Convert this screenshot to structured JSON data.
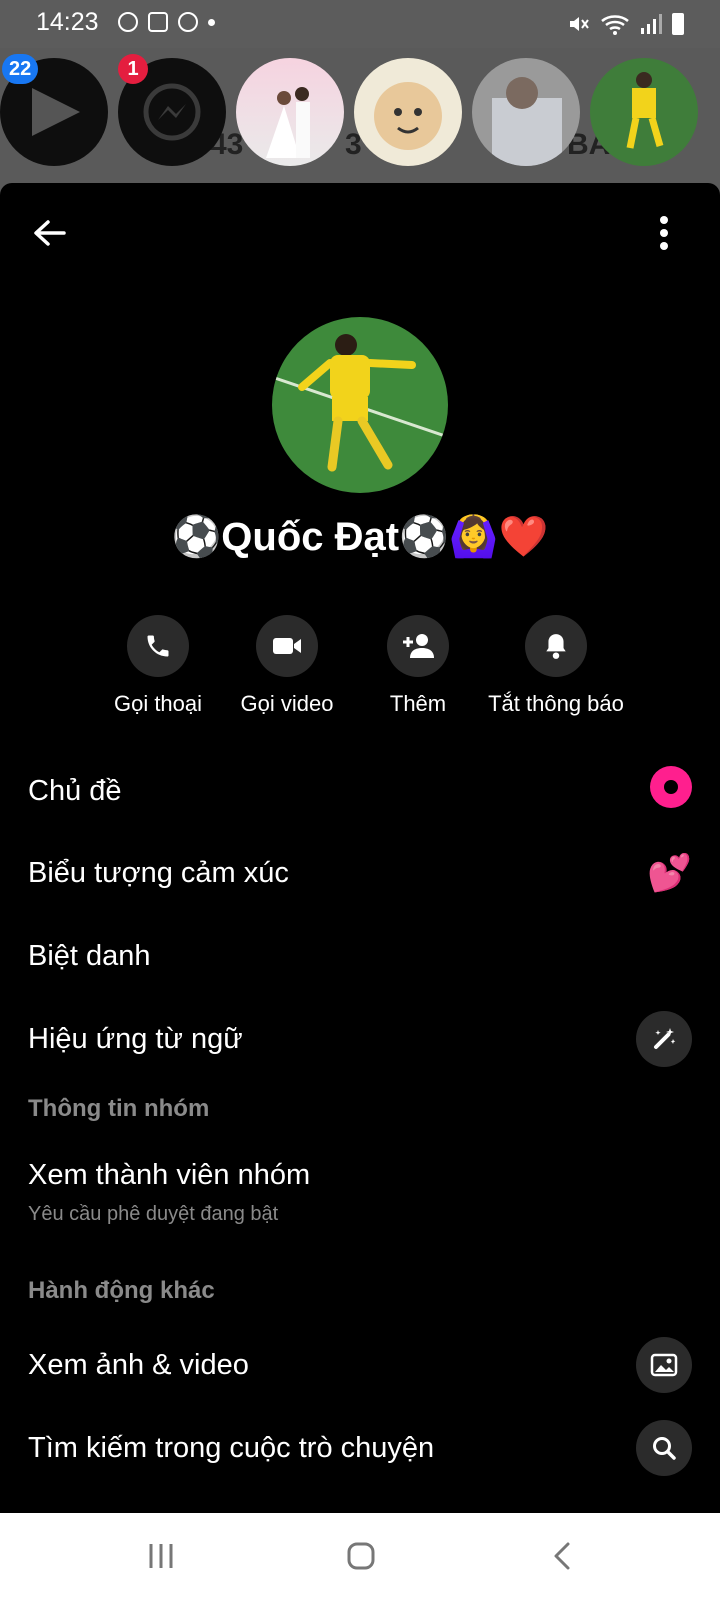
{
  "status_bar": {
    "time": "14:23"
  },
  "story_bubbles": {
    "play_badge": "22",
    "messenger_badge": "1",
    "bg_text_left": "43",
    "bg_text_mid": "3",
    "bg_text_right": "BẢ"
  },
  "profile": {
    "name": "⚽Quốc Đạt⚽🙆‍♀️❤️"
  },
  "actions": [
    {
      "label": "Gọi thoại",
      "icon": "phone-icon"
    },
    {
      "label": "Gọi video",
      "icon": "video-icon"
    },
    {
      "label": "Thêm",
      "icon": "add-person-icon"
    },
    {
      "label": "Tắt thông báo",
      "icon": "bell-icon"
    }
  ],
  "settings": {
    "theme": "Chủ đề",
    "emoji": "Biểu tượng cảm xúc",
    "emoji_value": "💕",
    "nickname": "Biệt danh",
    "word_effects": "Hiệu ứng từ ngữ",
    "group_info_header": "Thông tin nhóm",
    "view_members": "Xem thành viên nhóm",
    "view_members_sub": "Yêu cầu phê duyệt đang bật",
    "other_actions_header": "Hành động khác",
    "view_media": "Xem ảnh & video",
    "search_conversation": "Tìm kiếm trong cuộc trò chuyện"
  },
  "colors": {
    "theme_accent": "#ff1f8e",
    "sheet_bg": "#000000",
    "icon_circle_bg": "#2b2b2b",
    "badge_blue": "#1877f2",
    "badge_red": "#e41e3f"
  }
}
